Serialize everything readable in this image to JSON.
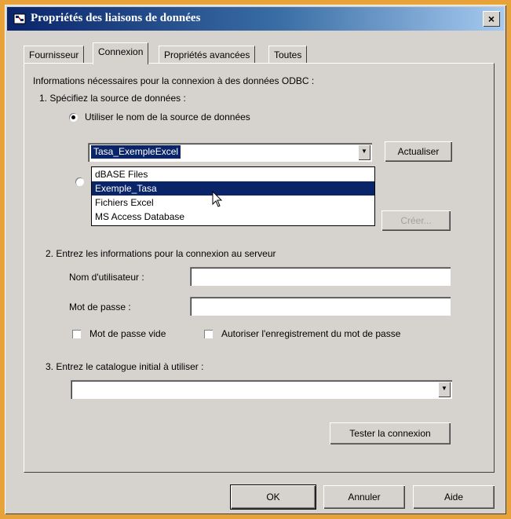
{
  "window": {
    "title": "Propriétés des liaisons de données",
    "close_glyph": "×"
  },
  "tabs": [
    {
      "label": "Fournisseur"
    },
    {
      "label": "Connexion"
    },
    {
      "label": "Propriétés avancées"
    },
    {
      "label": "Toutes"
    }
  ],
  "intro": "Informations nécessaires pour la connexion à des données ODBC :",
  "step1": {
    "label": "1. Spécifiez la source de données :",
    "radio_dsn_label": "Utiliser le nom de la source de données",
    "dsn_value": "Tasa_ExempleExcel",
    "refresh_label": "Actualiser",
    "create_label": "Créer...",
    "dropdown_items": [
      "dBASE Files",
      "Exemple_Tasa",
      "Fichiers Excel",
      "MS Access Database"
    ]
  },
  "step2": {
    "label": "2. Entrez les informations pour la connexion au serveur",
    "username_label": "Nom d'utilisateur :",
    "username_value": "",
    "password_label": "Mot de passe :",
    "password_value": "",
    "blank_password_label": "Mot de passe vide",
    "save_password_label": "Autoriser l'enregistrement du mot de passe"
  },
  "step3": {
    "label": "3. Entrez le catalogue initial à utiliser :",
    "catalog_value": ""
  },
  "test_button_label": "Tester la connexion",
  "footer": {
    "ok_label": "OK",
    "cancel_label": "Annuler",
    "help_label": "Aide"
  },
  "colors": {
    "face": "#d6d3ce",
    "highlight": "#0a246a",
    "frame": "#e8a23a"
  }
}
